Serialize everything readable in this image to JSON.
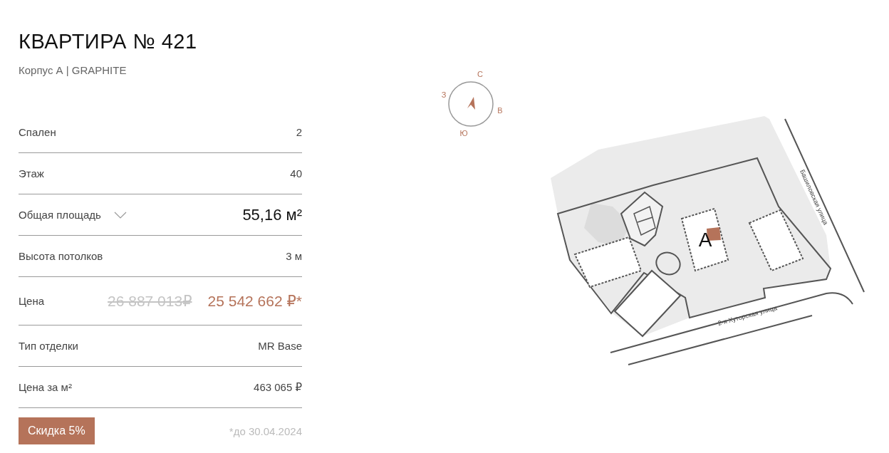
{
  "title": "КВАРТИРА № 421",
  "subtitle": "Корпус А | GRAPHITE",
  "rows": [
    {
      "kind": "plain",
      "label": "Спален",
      "value": "2"
    },
    {
      "kind": "plain",
      "label": "Этаж",
      "value": "40"
    },
    {
      "kind": "expandable",
      "label": "Общая площадь",
      "value": "55,16 м²",
      "expanded": false
    },
    {
      "kind": "plain",
      "label": "Высота потолков",
      "value": "3 м"
    },
    {
      "kind": "price",
      "label": "Цена",
      "old_value": "26 887 013₽",
      "value": "25 542 662 ₽*"
    },
    {
      "kind": "plain",
      "label": "Тип отделки",
      "value": "MR Base"
    },
    {
      "kind": "plain",
      "label": "Цена за м²",
      "value": "463 065 ₽"
    }
  ],
  "discount": {
    "badge": "Скидка 5%",
    "note": "*до 30.04.2024"
  },
  "compass": {
    "north": "С",
    "east": "В",
    "south": "Ю",
    "west": "З"
  },
  "site_plan": {
    "building_label": "A",
    "street_east": "Башиловская улица",
    "street_south": "2-я Хуторская улица"
  }
}
